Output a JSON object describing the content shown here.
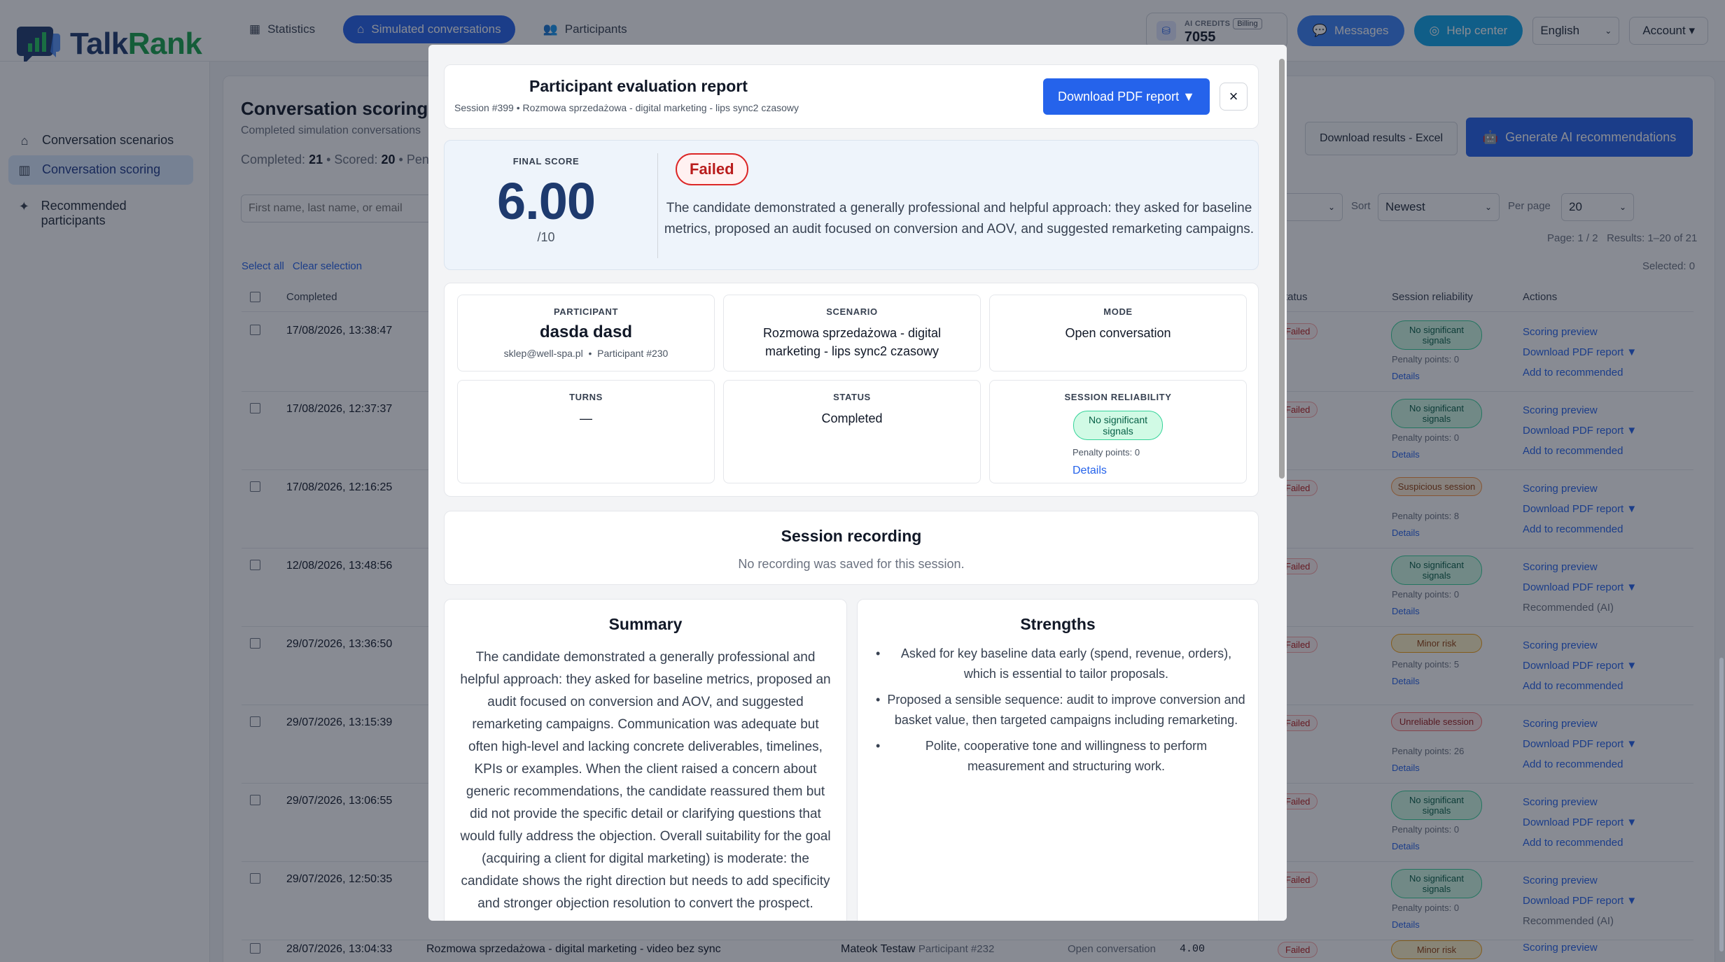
{
  "brand": {
    "name_a": "Talk",
    "name_b": "Rank"
  },
  "nav": {
    "tabs": [
      {
        "label": "Statistics",
        "icon": "grid-icon"
      },
      {
        "label": "Simulated conversations",
        "icon": "robot-icon"
      },
      {
        "label": "Participants",
        "icon": "users-icon"
      }
    ],
    "credits_label": "AI CREDITS",
    "credits_value": "7055",
    "billing": "Billing",
    "messages": "Messages",
    "help": "Help center",
    "language": "English",
    "account": "Account ▾"
  },
  "sidebar": {
    "items": [
      {
        "label": "Conversation scenarios"
      },
      {
        "label": "Conversation scoring"
      },
      {
        "label": "Recommended participants"
      }
    ]
  },
  "page": {
    "title": "Conversation scoring",
    "subtitle": "Completed simulation conversations",
    "completed_label": "Completed:",
    "completed": "21",
    "scored_label": "Scored:",
    "scored": "20",
    "pending_label": "Pend",
    "search_placeholder": "First name, last name, or email",
    "download_excel": "Download results - Excel",
    "generate_ai": "Generate AI recommendations",
    "sort_label": "Sort",
    "sort_value": "Newest",
    "per_page_label": "Per page",
    "per_page_value": "20",
    "page_info": "Page: 1 / 2",
    "results_info": "Results: 1–20 of 21",
    "selected_info": "Selected: 0",
    "select_all": "Select all",
    "clear_selection": "Clear selection"
  },
  "table": {
    "headers": {
      "completed": "Completed",
      "status": "Status",
      "reliability": "Session reliability",
      "actions": "Actions"
    },
    "rows": [
      {
        "date": "17/08/2026, 13:38:47",
        "rel": "No significant signals",
        "penalty": "Penalty points: 0",
        "recommended": false
      },
      {
        "date": "17/08/2026, 12:37:37",
        "rel": "No significant signals",
        "penalty": "Penalty points: 0",
        "recommended": false
      },
      {
        "date": "17/08/2026, 12:16:25",
        "rel": "Suspicious session",
        "penalty": "Penalty points: 8",
        "recommended": false
      },
      {
        "date": "12/08/2026, 13:48:56",
        "rel": "No significant signals",
        "penalty": "Penalty points: 0",
        "recommended": true
      },
      {
        "date": "29/07/2026, 13:36:50",
        "rel": "Minor risk",
        "penalty": "Penalty points: 5",
        "recommended": false
      },
      {
        "date": "29/07/2026, 13:15:39",
        "rel": "Unreliable session",
        "penalty": "Penalty points: 26",
        "recommended": false
      },
      {
        "date": "29/07/2026, 13:06:55",
        "rel": "No significant signals",
        "penalty": "Penalty points: 0",
        "recommended": false
      },
      {
        "date": "29/07/2026, 12:50:35",
        "rel": "No significant signals",
        "penalty": "Penalty points: 0",
        "recommended": true
      }
    ],
    "status_failed": "Failed",
    "details": "Details",
    "scoring_preview": "Scoring preview",
    "download_pdf": "Download PDF report ▼",
    "add_recommended": "Add to recommended",
    "recommended_ai": "Recommended (AI)",
    "last_row": {
      "date": "28/07/2026, 13:04:33",
      "scenario": "Rozmowa sprzedażowa - digital marketing - video bez sync",
      "participant": "Mateok Testaw",
      "participant_id": "Participant #232",
      "mode": "Open conversation",
      "score": "4.00",
      "status": "Failed",
      "rel": "Minor risk",
      "action": "Scoring preview"
    }
  },
  "modal": {
    "title": "Participant evaluation report",
    "subtitle": "Session #399 • Rozmowa sprzedażowa - digital marketing - lips sync2 czasowy",
    "download_pdf": "Download PDF report ▼",
    "close": "×",
    "final_score_label": "FINAL SCORE",
    "final_score": "6.00",
    "final_score_max": "/10",
    "result": "Failed",
    "result_text": "The candidate demonstrated a generally professional and helpful approach: they asked for baseline metrics, proposed an audit focused on conversion and AOV, and suggested remarketing campaigns.",
    "participant_label": "PARTICIPANT",
    "participant_name": "dasda dasd",
    "participant_email": "sklep@well-spa.pl",
    "participant_id": "Participant #230",
    "scenario_label": "SCENARIO",
    "scenario_value": "Rozmowa sprzedażowa - digital marketing - lips sync2 czasowy",
    "mode_label": "MODE",
    "mode_value": "Open conversation",
    "turns_label": "TURNS",
    "turns_value": "—",
    "status_label": "STATUS",
    "status_value": "Completed",
    "reliability_label": "SESSION RELIABILITY",
    "reliability_value": "No significant signals",
    "reliability_penalty": "Penalty points: 0",
    "reliability_details": "Details",
    "recording_title": "Session recording",
    "recording_text": "No recording was saved for this session.",
    "summary_title": "Summary",
    "summary_text": "The candidate demonstrated a generally professional and helpful approach: they asked for baseline metrics, proposed an audit focused on conversion and AOV, and suggested remarketing campaigns. Communication was adequate but often high-level and lacking concrete deliverables, timelines, KPIs or examples. When the client raised a concern about generic recommendations, the candidate reassured them but did not provide the specific detail or clarifying questions that would fully address the objection. Overall suitability for the goal (acquiring a client for digital marketing) is moderate: the candidate shows the right direction but needs to add specificity and stronger objection resolution to convert the prospect.",
    "strengths_title": "Strengths",
    "strengths": [
      "Asked for key baseline data early (spend, revenue, orders), which is essential to tailor proposals.",
      "Proposed a sensible sequence: audit to improve conversion and basket value, then targeted campaigns including remarketing.",
      "Polite, cooperative tone and willingness to perform measurement and structuring work."
    ]
  },
  "colors": {
    "primary": "#2563eb",
    "brand_navy": "#1e3a6e",
    "brand_green": "#16a34a",
    "danger": "#dc2626",
    "success_bg": "#d1fae5"
  }
}
